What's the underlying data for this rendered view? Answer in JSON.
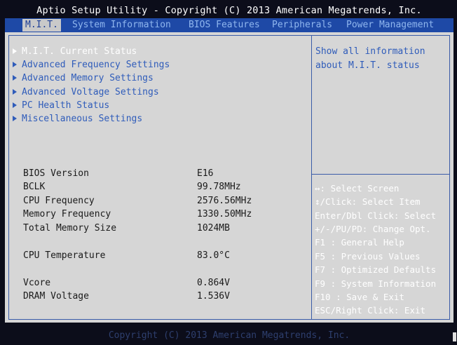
{
  "header": {
    "title": "Aptio Setup Utility - Copyright (C) 2013 American Megatrends, Inc."
  },
  "tabs": [
    {
      "label": "M.I.T.",
      "active": true
    },
    {
      "label": "System Information",
      "active": false
    },
    {
      "label": "BIOS Features",
      "active": false
    },
    {
      "label": "Peripherals",
      "active": false
    },
    {
      "label": "Power Management",
      "active": false
    }
  ],
  "menu": {
    "items": [
      {
        "label": "M.I.T. Current Status",
        "selected": true
      },
      {
        "label": "Advanced Frequency Settings",
        "selected": false
      },
      {
        "label": "Advanced Memory Settings",
        "selected": false
      },
      {
        "label": "Advanced Voltage Settings",
        "selected": false
      },
      {
        "label": "PC Health Status",
        "selected": false
      },
      {
        "label": "Miscellaneous Settings",
        "selected": false
      }
    ]
  },
  "info": {
    "bios_version": {
      "label": "BIOS Version",
      "value": "E16"
    },
    "bclk": {
      "label": "BCLK",
      "value": "99.78MHz"
    },
    "cpu_frequency": {
      "label": "CPU Frequency",
      "value": "2576.56MHz"
    },
    "memory_frequency": {
      "label": "Memory Frequency",
      "value": "1330.50MHz"
    },
    "total_memory_size": {
      "label": "Total Memory Size",
      "value": "1024MB"
    },
    "cpu_temperature": {
      "label": "CPU Temperature",
      "value": "83.0°C"
    },
    "vcore": {
      "label": "Vcore",
      "value": "0.864V"
    },
    "dram_voltage": {
      "label": "DRAM Voltage",
      "value": "1.536V"
    }
  },
  "help": {
    "line1": "Show all information",
    "line2": "about M.I.T. status"
  },
  "keys": [
    "↔: Select Screen",
    "↕/Click: Select Item",
    "Enter/Dbl Click: Select",
    "+/-/PU/PD: Change Opt.",
    "F1  : General Help",
    "F5  : Previous Values",
    "F7  : Optimized Defaults",
    "F9  : System Information",
    "F10 : Save & Exit",
    "ESC/Right Click: Exit"
  ],
  "footer": {
    "text": "Copyright (C) 2013 American Megatrends, Inc."
  },
  "colors": {
    "background": "#0c0d1a",
    "tab_bar": "#1e49a6",
    "panel": "#d6d6d6",
    "accent_text": "#2f5cba"
  }
}
